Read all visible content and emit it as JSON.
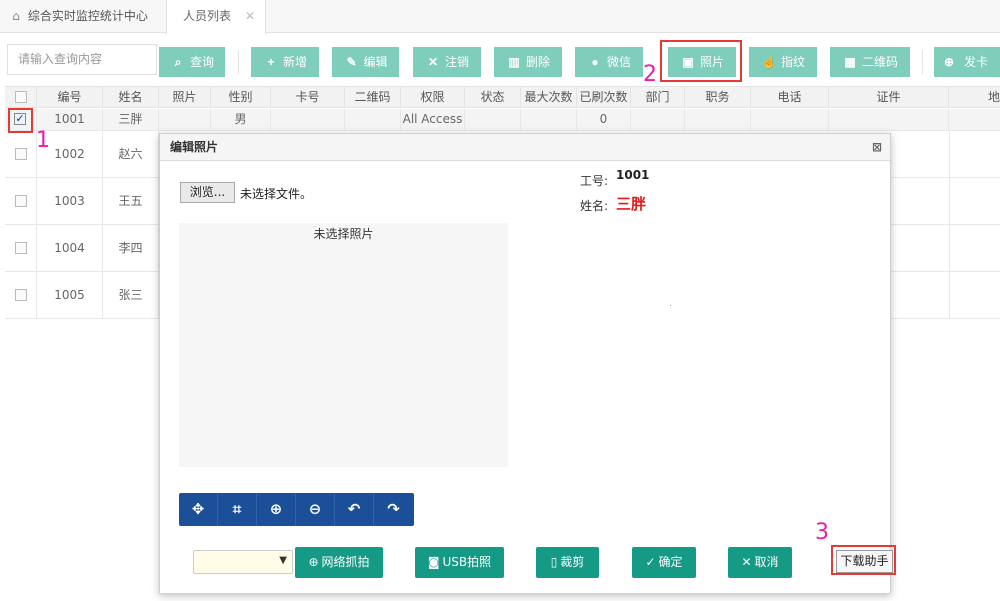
{
  "tabs": [
    {
      "label": "综合实时监控统计中心",
      "icon": "home-icon"
    },
    {
      "label": "人员列表",
      "close": "✕"
    }
  ],
  "toolbar": {
    "search_placeholder": "请输入查询内容",
    "buttons": [
      {
        "label": "查询",
        "icon": "search-icon"
      },
      {
        "label": "新增",
        "icon": "plus-icon"
      },
      {
        "label": "编辑",
        "icon": "pencil-icon"
      },
      {
        "label": "注销",
        "icon": "close-icon"
      },
      {
        "label": "删除",
        "icon": "trash-icon"
      },
      {
        "label": "微信",
        "icon": "wechat-icon"
      },
      {
        "label": "照片",
        "icon": "image-icon"
      },
      {
        "label": "指纹",
        "icon": "thumb-icon"
      },
      {
        "label": "二维码",
        "icon": "qrcode-icon"
      },
      {
        "label": "发卡",
        "icon": "plus-circle-icon"
      }
    ]
  },
  "table": {
    "columns": [
      "编号",
      "姓名",
      "照片",
      "性别",
      "卡号",
      "二维码",
      "权限",
      "状态",
      "最大次数",
      "已刷次数",
      "部门",
      "职务",
      "电话",
      "证件",
      "地"
    ],
    "rows": [
      {
        "id": "1001",
        "name": "三胖",
        "gender": "男",
        "permission": "All Access",
        "count": "0",
        "checked": true
      },
      {
        "id": "1002",
        "name": "赵六"
      },
      {
        "id": "1003",
        "name": "王五"
      },
      {
        "id": "1004",
        "name": "李四"
      },
      {
        "id": "1005",
        "name": "张三"
      }
    ]
  },
  "annotations": {
    "m1": "1",
    "m2": "2",
    "m3": "3"
  },
  "modal": {
    "title": "编辑照片",
    "close": "⊠",
    "browse_label": "浏览...",
    "no_file": "未选择文件。",
    "no_photo": "未选择照片",
    "id_label": "工号:",
    "id_value": "1001",
    "name_label": "姓名:",
    "name_value": "三胖",
    "edit_tools": [
      "move-icon",
      "crop-icon",
      "zoom-in-icon",
      "zoom-out-icon",
      "undo-icon",
      "redo-icon"
    ],
    "buttons": {
      "web_capture": "网络抓拍",
      "usb_capture": "USB拍照",
      "crop": "裁剪",
      "confirm": "确定",
      "cancel": "取消",
      "download": "下载助手"
    }
  },
  "colors": {
    "toolbar_button": "#7fcdbb",
    "modal_button": "#159a85",
    "edit_bar": "#1b4f97",
    "highlight": "#e53935",
    "marker": "#e91eac",
    "name_red": "#e01b1b"
  }
}
